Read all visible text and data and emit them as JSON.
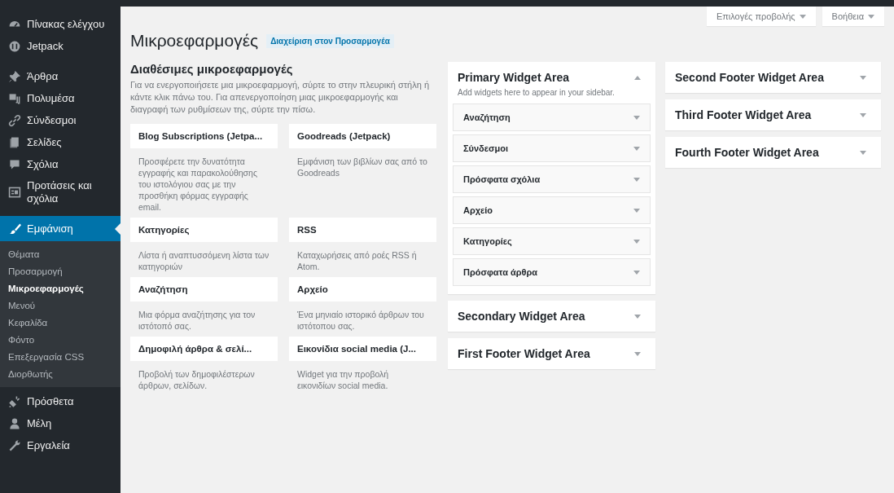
{
  "sidebar": {
    "items": [
      {
        "label": "Πίνακας ελέγχου",
        "selected": false
      },
      {
        "label": "Jetpack",
        "selected": false
      },
      {
        "label": "Άρθρα",
        "selected": false
      },
      {
        "label": "Πολυμέσα",
        "selected": false
      },
      {
        "label": "Σύνδεσμοι",
        "selected": false
      },
      {
        "label": "Σελίδες",
        "selected": false
      },
      {
        "label": "Σχόλια",
        "selected": false
      },
      {
        "label": "Προτάσεις και σχόλια",
        "selected": false
      },
      {
        "label": "Εμφάνιση",
        "selected": true,
        "children": [
          {
            "label": "Θέματα",
            "selected": false
          },
          {
            "label": "Προσαρμογή",
            "selected": false
          },
          {
            "label": "Μικροεφαρμογές",
            "selected": true
          },
          {
            "label": "Μενού",
            "selected": false
          },
          {
            "label": "Κεφαλίδα",
            "selected": false
          },
          {
            "label": "Φόντο",
            "selected": false
          },
          {
            "label": "Επεξεργασία CSS",
            "selected": false
          },
          {
            "label": "Διορθωτής",
            "selected": false
          }
        ]
      },
      {
        "label": "Πρόσθετα",
        "selected": false
      },
      {
        "label": "Μέλη",
        "selected": false
      },
      {
        "label": "Εργαλεία",
        "selected": false
      }
    ]
  },
  "screen_options": [
    {
      "label": "Επιλογές προβολής",
      "expanded": false
    },
    {
      "label": "Βοήθεια",
      "expanded": false
    }
  ],
  "page": {
    "title": "Μικροεφαρμογές",
    "action_link": "Διαχείριση στον Προσαρμογέα"
  },
  "available_widgets": {
    "title": "Διαθέσιμες μικροεφαρμογές",
    "description": "Για να ενεργοποιήσετε μια μικροεφαρμογή, σύρτε το στην πλευρική στήλη ή κάντε κλικ πάνω του. Για απενεργοποίηση μιας μικροεφαρμογής και διαγραφή των ρυθμίσεων της, σύρτε την πίσω.",
    "widgets": [
      {
        "title": "Blog Subscriptions (Jetpa...",
        "description": "Προσφέρετε την δυνατότητα εγγραφής και παρακολούθησης του ιστολόγιου σας με την προσθήκη φόρμας εγγραφής email."
      },
      {
        "title": "Goodreads (Jetpack)",
        "description": "Εμφάνιση των βιβλίων σας από το Goodreads"
      },
      {
        "title": "Κατηγορίες",
        "description": "Λίστα ή αναπτυσσόμενη λίστα των κατηγοριών"
      },
      {
        "title": "RSS",
        "description": "Καταχωρήσεις από ροές RSS ή Atom."
      },
      {
        "title": "Αναζήτηση",
        "description": "Μια φόρμα αναζήτησης για τον ιστότοπό σας."
      },
      {
        "title": "Αρχείο",
        "description": "Ένα μηνιαίο ιστορικό άρθρων του ιστότοπου σας."
      },
      {
        "title": "Δημοφιλή άρθρα & σελί...",
        "description": "Προβολή των δημοφιλέστερων άρθρων, σελίδων."
      },
      {
        "title": "Εικονίδια social media (J...",
        "description": "Widget για την προβολή εικονιδίων social media."
      }
    ]
  },
  "widget_areas": [
    [
      {
        "title": "Primary Widget Area",
        "expanded": true,
        "description": "Add widgets here to appear in your sidebar.",
        "widgets": [
          "Αναζήτηση",
          "Σύνδεσμοι",
          "Πρόσφατα σχόλια",
          "Αρχείο",
          "Κατηγορίες",
          "Πρόσφατα άρθρα"
        ]
      },
      {
        "title": "Secondary Widget Area",
        "expanded": false
      },
      {
        "title": "First Footer Widget Area",
        "expanded": false
      }
    ],
    [
      {
        "title": "Second Footer Widget Area",
        "expanded": false
      },
      {
        "title": "Third Footer Widget Area",
        "expanded": false
      },
      {
        "title": "Fourth Footer Widget Area",
        "expanded": false
      }
    ]
  ]
}
